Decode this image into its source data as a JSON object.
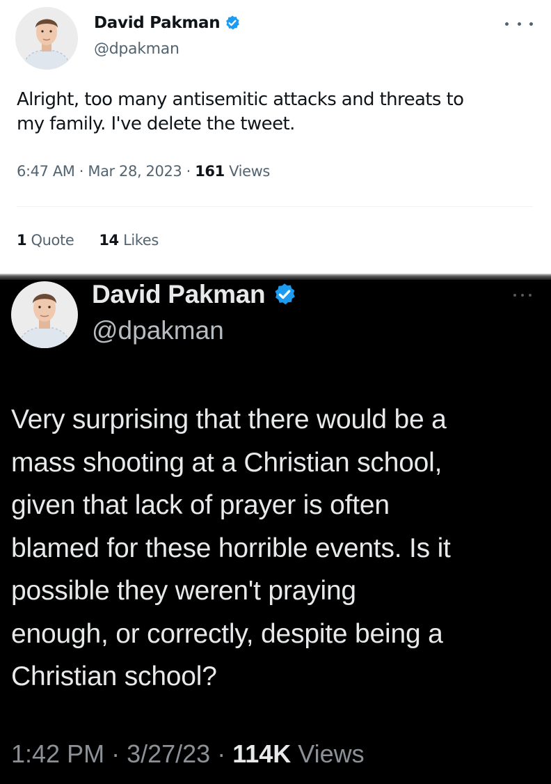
{
  "tweet_top": {
    "name": "David Pakman",
    "handle": "@dpakman",
    "text": "Alright, too many antisemitic attacks and threats to\nmy family. I've delete the tweet.",
    "time": "6:47 AM",
    "date": "Mar 28, 2023",
    "views_count": "161",
    "views_label": "Views",
    "quotes_count": "1",
    "quotes_label": "Quote",
    "likes_count": "14",
    "likes_label": "Likes",
    "verified_color": "#1d9bf0",
    "theme": "light"
  },
  "tweet_bottom": {
    "name": "David Pakman",
    "handle": "@dpakman",
    "text": "Very surprising that there would be a\nmass shooting at a Christian school,\ngiven that lack of prayer is often\nblamed for these horrible events. Is it\npossible they weren't praying\nenough, or correctly, despite being a\nChristian school?",
    "time": "1:42 PM",
    "date": "3/27/23",
    "views_count": "114K",
    "views_label": "Views",
    "verified_color": "#1d9bf0",
    "theme": "dark"
  },
  "separator": " · ",
  "icons": [
    "avatar",
    "verified-badge-icon",
    "more-options-icon"
  ]
}
